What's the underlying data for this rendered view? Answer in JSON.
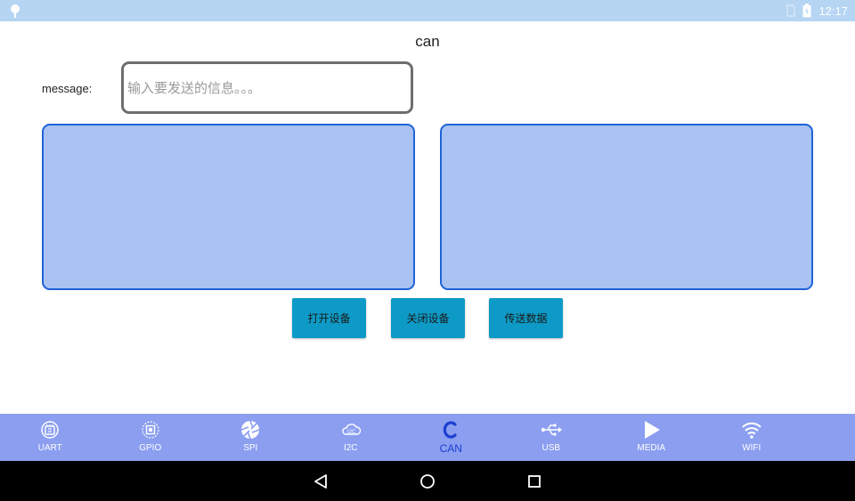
{
  "status_bar": {
    "time": "12:17",
    "left_icon": "android-debug-icon",
    "icons": [
      "sim-card-icon",
      "battery-icon"
    ],
    "background": "#b5d5f3"
  },
  "page": {
    "title": "can",
    "message_label": "message:",
    "message_input": {
      "value": "",
      "placeholder": "输入要发送的信息。。。"
    },
    "left_panel_text": "",
    "right_panel_text": ""
  },
  "buttons": {
    "open_device": "打开设备",
    "close_device": "关闭设备",
    "send_data": "传送数据"
  },
  "tabs": [
    {
      "label": "UART",
      "icon": "uart-icon",
      "active": false
    },
    {
      "label": "GPIO",
      "icon": "gpio-chip-icon",
      "active": false
    },
    {
      "label": "SPI",
      "icon": "spi-aperture-icon",
      "active": false
    },
    {
      "label": "I2C",
      "icon": "i2c-cloud-icon",
      "active": false
    },
    {
      "label": "CAN",
      "icon": "can-c-icon",
      "active": true
    },
    {
      "label": "USB",
      "icon": "usb-icon",
      "active": false
    },
    {
      "label": "MEDIA",
      "icon": "play-icon",
      "active": false
    },
    {
      "label": "WIFI",
      "icon": "wifi-icon",
      "active": false
    }
  ],
  "colors": {
    "tab_bar": "#8b9ef0",
    "tab_active": "#1b3fd0",
    "panel_fill": "#a9c2f2",
    "panel_border": "#1e63d8",
    "button": "#0e9ac6"
  },
  "nav_bar": {
    "icons": [
      "back-icon",
      "home-icon",
      "recents-icon"
    ]
  }
}
